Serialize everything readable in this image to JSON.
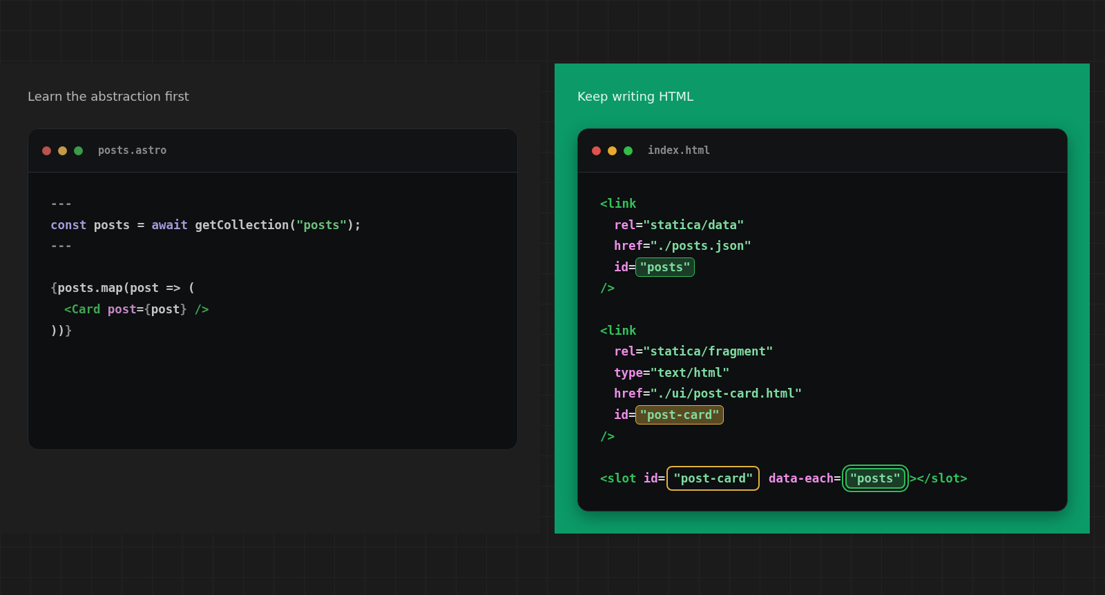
{
  "panels": [
    {
      "kind": "plain",
      "title": "Learn the abstraction first",
      "window": {
        "filename": "posts.astro",
        "blocks": [
          [
            {
              "indented": false,
              "tokens": [
                {
                  "t": "---",
                  "kind": "punct"
                }
              ]
            },
            {
              "indented": false,
              "tokens": [
                {
                  "t": "const",
                  "kind": "keyword"
                },
                {
                  "t": " posts = ",
                  "kind": "plain"
                },
                {
                  "t": "await",
                  "kind": "keyword"
                },
                {
                  "t": " getCollection(",
                  "kind": "plain"
                },
                {
                  "t": "\"posts\"",
                  "kind": "string"
                },
                {
                  "t": ");",
                  "kind": "plain"
                }
              ]
            },
            {
              "indented": false,
              "tokens": [
                {
                  "t": "---",
                  "kind": "punct"
                }
              ]
            }
          ],
          [
            {
              "indented": false,
              "tokens": [
                {
                  "t": "{",
                  "kind": "punct"
                },
                {
                  "t": "posts.map(post => (",
                  "kind": "plain"
                }
              ]
            },
            {
              "indented": true,
              "tokens": [
                {
                  "t": "<Card",
                  "kind": "tag"
                },
                {
                  "t": " post",
                  "kind": "attr"
                },
                {
                  "t": "=",
                  "kind": "plain"
                },
                {
                  "t": "{",
                  "kind": "punct"
                },
                {
                  "t": "post",
                  "kind": "plain"
                },
                {
                  "t": "}",
                  "kind": "punct"
                },
                {
                  "t": " />",
                  "kind": "tag"
                }
              ]
            },
            {
              "indented": false,
              "tokens": [
                {
                  "t": "))",
                  "kind": "plain"
                },
                {
                  "t": "}",
                  "kind": "punct"
                }
              ]
            }
          ]
        ]
      }
    },
    {
      "kind": "accent",
      "title": "Keep writing HTML",
      "window": {
        "filename": "index.html",
        "blocks": [
          [
            {
              "indented": false,
              "tokens": [
                {
                  "t": "<link",
                  "kind": "tag"
                }
              ]
            },
            {
              "indented": true,
              "tokens": [
                {
                  "t": "rel",
                  "kind": "attr"
                },
                {
                  "t": "=",
                  "kind": "plain"
                },
                {
                  "t": "\"statica/data\"",
                  "kind": "string"
                }
              ]
            },
            {
              "indented": true,
              "tokens": [
                {
                  "t": "href",
                  "kind": "attr"
                },
                {
                  "t": "=",
                  "kind": "plain"
                },
                {
                  "t": "\"./posts.json\"",
                  "kind": "string"
                }
              ]
            },
            {
              "indented": true,
              "tokens": [
                {
                  "t": "id",
                  "kind": "attr"
                },
                {
                  "t": "=",
                  "kind": "plain"
                },
                {
                  "t": "\"posts\"",
                  "kind": "hl-green"
                }
              ]
            },
            {
              "indented": false,
              "tokens": [
                {
                  "t": "/>",
                  "kind": "tag"
                }
              ]
            }
          ],
          [
            {
              "indented": false,
              "tokens": [
                {
                  "t": "<link",
                  "kind": "tag"
                }
              ]
            },
            {
              "indented": true,
              "tokens": [
                {
                  "t": "rel",
                  "kind": "attr"
                },
                {
                  "t": "=",
                  "kind": "plain"
                },
                {
                  "t": "\"statica/fragment\"",
                  "kind": "string"
                }
              ]
            },
            {
              "indented": true,
              "tokens": [
                {
                  "t": "type",
                  "kind": "attr"
                },
                {
                  "t": "=",
                  "kind": "plain"
                },
                {
                  "t": "\"text/html\"",
                  "kind": "string"
                }
              ]
            },
            {
              "indented": true,
              "tokens": [
                {
                  "t": "href",
                  "kind": "attr"
                },
                {
                  "t": "=",
                  "kind": "plain"
                },
                {
                  "t": "\"./ui/post-card.html\"",
                  "kind": "string"
                }
              ]
            },
            {
              "indented": true,
              "tokens": [
                {
                  "t": "id",
                  "kind": "attr"
                },
                {
                  "t": "=",
                  "kind": "plain"
                },
                {
                  "t": "\"post-card\"",
                  "kind": "hl-yellow"
                }
              ]
            },
            {
              "indented": false,
              "tokens": [
                {
                  "t": "/>",
                  "kind": "tag"
                }
              ]
            }
          ],
          [
            {
              "indented": false,
              "tokens": [
                {
                  "t": "<slot",
                  "kind": "tag"
                },
                {
                  "t": " id",
                  "kind": "attr"
                },
                {
                  "t": "=",
                  "kind": "plain"
                },
                {
                  "t": "\"post-card\"",
                  "kind": "ring-yellow"
                },
                {
                  "t": " data-each",
                  "kind": "attr"
                },
                {
                  "t": "=",
                  "kind": "plain"
                },
                {
                  "t": "\"posts\"",
                  "kind": "ring-green"
                },
                {
                  "t": "></slot>",
                  "kind": "tag"
                }
              ]
            }
          ]
        ]
      }
    }
  ]
}
